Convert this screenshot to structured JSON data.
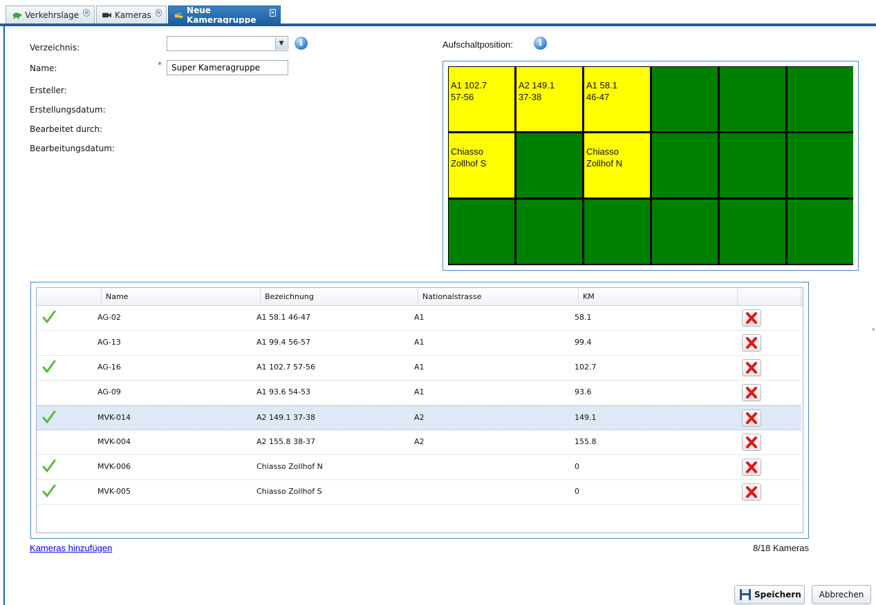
{
  "tabs": [
    {
      "label": "Verkehrslage",
      "icon": "turtle-icon",
      "active": false
    },
    {
      "label": "Kameras",
      "icon": "camera-icon",
      "active": false
    },
    {
      "label": "Neue Kameragruppe",
      "icon": "camera-group-icon",
      "active": true
    }
  ],
  "form": {
    "directory_label": "Verzeichnis:",
    "directory_value": "",
    "name_label": "Name:",
    "name_required": "*",
    "name_value": "Super Kameragruppe",
    "creator_label": "Ersteller:",
    "created_label": "Erstellungsdatum:",
    "edited_by_label": "Bearbeitet durch:",
    "edited_date_label": "Bearbeitungsdatum:"
  },
  "position": {
    "label": "Aufschaltposition:",
    "cells": [
      {
        "line1": "A1 102.7",
        "line2": "57-56",
        "occupied": true
      },
      {
        "line1": "A2 149.1",
        "line2": "37-38",
        "occupied": true
      },
      {
        "line1": "A1 58.1",
        "line2": "46-47",
        "occupied": true
      },
      {
        "line1": "",
        "line2": "",
        "occupied": false
      },
      {
        "line1": "",
        "line2": "",
        "occupied": false
      },
      {
        "line1": "",
        "line2": "",
        "occupied": false
      },
      {
        "line1": "Chiasso",
        "line2": "Zollhof S",
        "occupied": true
      },
      {
        "line1": "",
        "line2": "",
        "occupied": false
      },
      {
        "line1": "Chiasso",
        "line2": "Zollhof N",
        "occupied": true
      },
      {
        "line1": "",
        "line2": "",
        "occupied": false
      },
      {
        "line1": "",
        "line2": "",
        "occupied": false
      },
      {
        "line1": "",
        "line2": "",
        "occupied": false
      },
      {
        "line1": "",
        "line2": "",
        "occupied": false
      },
      {
        "line1": "",
        "line2": "",
        "occupied": false
      },
      {
        "line1": "",
        "line2": "",
        "occupied": false
      },
      {
        "line1": "",
        "line2": "",
        "occupied": false
      },
      {
        "line1": "",
        "line2": "",
        "occupied": false
      },
      {
        "line1": "",
        "line2": "",
        "occupied": false
      }
    ],
    "colors": {
      "occupied": "#ffff00",
      "free": "#008000"
    }
  },
  "table": {
    "columns": [
      "Name",
      "Bezeichnung",
      "Nationalstrasse",
      "KM"
    ],
    "rows": [
      {
        "checked": true,
        "name": "AG-02",
        "bezeichnung": "A1 58.1 46-47",
        "strasse": "A1",
        "km": "58.1",
        "selected": false
      },
      {
        "checked": false,
        "name": "AG-13",
        "bezeichnung": "A1 99.4 56-57",
        "strasse": "A1",
        "km": "99.4",
        "selected": false
      },
      {
        "checked": true,
        "name": "AG-16",
        "bezeichnung": "A1 102.7 57-56",
        "strasse": "A1",
        "km": "102.7",
        "selected": false
      },
      {
        "checked": false,
        "name": "AG-09",
        "bezeichnung": "A1 93.6 54-53",
        "strasse": "A1",
        "km": "93.6",
        "selected": false
      },
      {
        "checked": true,
        "name": "MVK-014",
        "bezeichnung": "A2 149.1 37-38",
        "strasse": "A2",
        "km": "149.1",
        "selected": true
      },
      {
        "checked": false,
        "name": "MVK-004",
        "bezeichnung": "A2 155.8 38-37",
        "strasse": "A2",
        "km": "155.8",
        "selected": false
      },
      {
        "checked": true,
        "name": "MVK-006",
        "bezeichnung": "Chiasso Zollhof N",
        "strasse": "",
        "km": "0",
        "selected": false
      },
      {
        "checked": true,
        "name": "MVK-005",
        "bezeichnung": "Chiasso Zollhof S",
        "strasse": "",
        "km": "0",
        "selected": false
      }
    ]
  },
  "footer": {
    "add_link": "Kameras hinzufügen",
    "count": "8/18 Kameras",
    "save_label": "Speichern",
    "cancel_label": "Abbrechen"
  },
  "colors": {
    "accent": "#1f5fa0",
    "selected_row": "#dfe8f6",
    "link": "#0000ee"
  }
}
